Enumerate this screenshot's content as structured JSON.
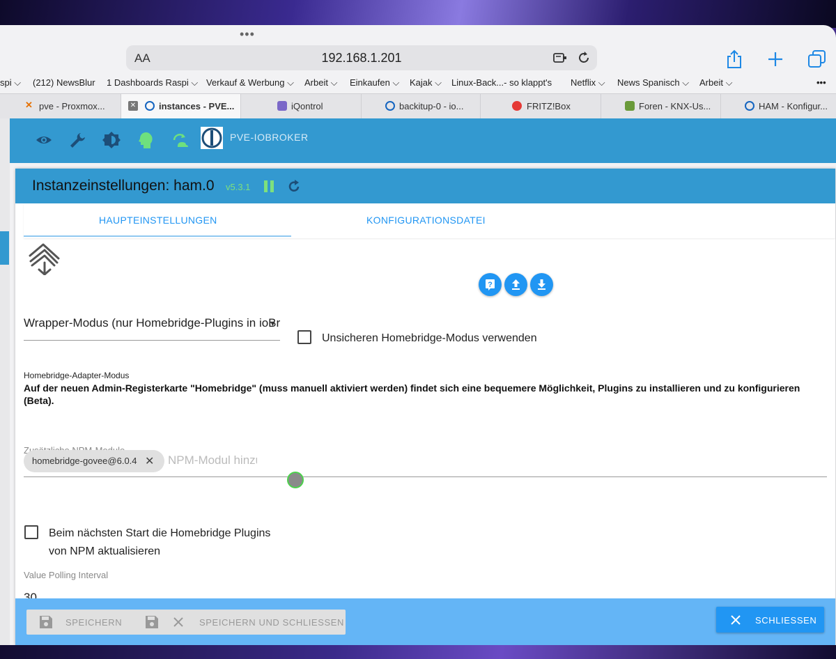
{
  "browser": {
    "reader_label": "AA",
    "url": "192.168.1.201",
    "bookmarks": [
      {
        "label": "spi",
        "has_chevron": true
      },
      {
        "label": "(212) NewsBlur",
        "has_chevron": false
      },
      {
        "label": "1 Dashboards Raspi",
        "has_chevron": true
      },
      {
        "label": "Verkauf & Werbung",
        "has_chevron": true
      },
      {
        "label": "Arbeit",
        "has_chevron": true
      },
      {
        "label": "Einkaufen",
        "has_chevron": true
      },
      {
        "label": "Kajak",
        "has_chevron": true
      },
      {
        "label": "Linux-Back...- so klappt's",
        "has_chevron": false
      },
      {
        "label": "Netflix",
        "has_chevron": true
      },
      {
        "label": "News Spanisch",
        "has_chevron": true
      },
      {
        "label": "Arbeit",
        "has_chevron": true
      }
    ],
    "more_label": "•••",
    "tabs": [
      {
        "label": "pve - Proxmox...",
        "favicon": "proxmox-icon",
        "color": "#e57000"
      },
      {
        "label": "instances - PVE...",
        "favicon": "iobroker-icon",
        "color": "#1565c0",
        "active": true,
        "close_label": "✕"
      },
      {
        "label": "iQontrol",
        "favicon": "iqontrol-icon",
        "color": "#7b68c8"
      },
      {
        "label": "backitup-0 - io...",
        "favicon": "iobroker-icon",
        "color": "#1565c0"
      },
      {
        "label": "FRITZ!Box",
        "favicon": "fritzbox-icon",
        "color": "#e53935"
      },
      {
        "label": "Foren - KNX-Us...",
        "favicon": "knx-icon",
        "color": "#6a9a3a"
      },
      {
        "label": "HAM - Konfigur...",
        "favicon": "iobroker-icon",
        "color": "#1565c0"
      }
    ]
  },
  "app": {
    "host_name": "PVE-IOBROKER",
    "toolbar_icons": [
      "eye-icon",
      "wrench-icon",
      "brightness-icon",
      "expert-mode-icon",
      "refresh-cloud-icon",
      "iobroker-logo"
    ]
  },
  "dialog": {
    "title": "Instanzeinstellungen: ham.0",
    "version": "v5.3.1",
    "tabs": [
      "HAUPTEINSTELLUNGEN",
      "KONFIGURATIONSDATEI"
    ],
    "active_tab": 0,
    "mode_select": {
      "value": "Wrapper-Modus (nur Homebridge-Plugins in ioBroker)",
      "helper": "Homebridge-Adapter-Modus"
    },
    "insecure_checkbox": {
      "label": "Unsicheren Homebridge-Modus verwenden",
      "checked": false
    },
    "note": "Auf der neuen Admin-Registerkarte \"Homebridge\" (muss manuell aktiviert werden) findet sich eine bequemere Möglichkeit, Plugins zu installieren und zu konfigurieren (Beta).",
    "npm": {
      "label": "Zusätzliche NPM-Module",
      "chips": [
        "homebridge-govee@6.0.4"
      ],
      "placeholder": "NPM-Modul hinzufügen"
    },
    "update_checkbox": {
      "label": "Beim nächsten Start die Homebridge Plugins von NPM aktualisieren",
      "checked": false
    },
    "polling": {
      "label": "Value Polling Interval",
      "value": "30"
    },
    "footer": {
      "save_label": "SPEICHERN",
      "save_close_label": "SPEICHERN UND SCHLIESSEN",
      "close_label": "SCHLIESSEN"
    }
  },
  "colors": {
    "accent": "#3399d0",
    "primary": "#2196f3",
    "footer": "#64b5f6",
    "version": "#7de07d"
  }
}
